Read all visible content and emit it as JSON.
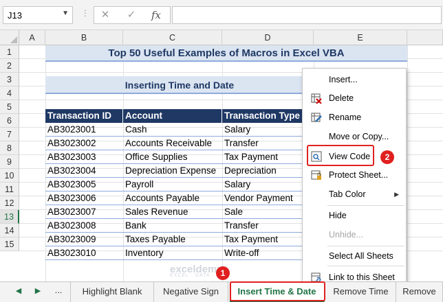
{
  "formula_bar": {
    "name_box": "J13",
    "cancel_icon": "✕",
    "enter_icon": "✓",
    "fx_label": "fx",
    "formula": ""
  },
  "columns": [
    "A",
    "B",
    "C",
    "D",
    "E"
  ],
  "rows": [
    "1",
    "2",
    "3",
    "4",
    "5",
    "6",
    "7",
    "8",
    "9",
    "10",
    "11",
    "12",
    "13",
    "14",
    "15"
  ],
  "selected_row": "13",
  "sheet": {
    "title": "Top 50 Useful Examples of Macros in Excel VBA",
    "subtitle": "Inserting Time and Date",
    "table_headers": [
      "Transaction ID",
      "Account",
      "Transaction Type"
    ],
    "table_rows": [
      [
        "AB3023001",
        "Cash",
        "Salary"
      ],
      [
        "AB3023002",
        "Accounts Receivable",
        "Transfer"
      ],
      [
        "AB3023003",
        "Office Supplies",
        "Tax Payment"
      ],
      [
        "AB3023004",
        "Depreciation Expense",
        "Depreciation"
      ],
      [
        "AB3023005",
        "Payroll",
        "Salary"
      ],
      [
        "AB3023006",
        "Accounts Payable",
        "Vendor Payment"
      ],
      [
        "AB3023007",
        "Sales Revenue",
        "Sale"
      ],
      [
        "AB3023008",
        "Bank",
        "Transfer"
      ],
      [
        "AB3023009",
        "Taxes Payable",
        "Tax Payment"
      ],
      [
        "AB3023010",
        "Inventory",
        "Write-off"
      ]
    ]
  },
  "context_menu": {
    "items": [
      {
        "label": "Insert...",
        "icon": "",
        "disabled": false
      },
      {
        "label": "Delete",
        "icon": "delete-sheet-icon",
        "disabled": false
      },
      {
        "label": "Rename",
        "icon": "rename-sheet-icon",
        "disabled": false
      },
      {
        "label": "Move or Copy...",
        "icon": "",
        "disabled": false
      },
      {
        "label": "View Code",
        "icon": "view-code-icon",
        "disabled": false
      },
      {
        "label": "Protect Sheet...",
        "icon": "protect-sheet-icon",
        "disabled": false
      },
      {
        "label": "Tab Color",
        "icon": "",
        "disabled": false
      },
      {
        "label": "Hide",
        "icon": "",
        "disabled": false
      },
      {
        "label": "Unhide...",
        "icon": "",
        "disabled": true
      },
      {
        "label": "Select All Sheets",
        "icon": "",
        "disabled": false
      },
      {
        "label": "Link to this Sheet",
        "icon": "link-icon",
        "disabled": false
      }
    ],
    "submenu_arrow": "▶"
  },
  "badges": {
    "tab_step": "1",
    "menu_step": "2"
  },
  "tabs": {
    "nav_prev": "◀",
    "nav_next": "▶",
    "ellipsis": "...",
    "items": [
      "Highlight Blank",
      "Negative Sign",
      "Insert Time & Date",
      "Remove Time",
      "Remove"
    ],
    "active": "Insert Time & Date"
  },
  "watermark": {
    "brand": "exceldemy",
    "tagline": "EXCEL · DATA · BI"
  },
  "colors": {
    "header_fill": "#1f3864",
    "title_fill": "#dbe5f1",
    "accent": "#217346",
    "highlight": "#e02020"
  }
}
